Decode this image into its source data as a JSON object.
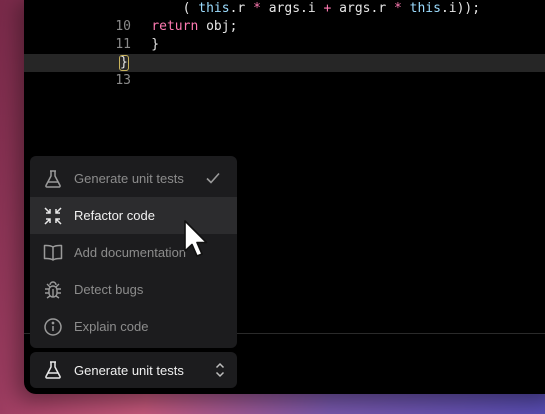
{
  "code": {
    "lines": [
      {
        "number": "10",
        "text": "        ( this.r * args.i + args.r * this.i));"
      },
      {
        "number": "11",
        "text": "    return obj;"
      },
      {
        "number": "12",
        "text": "    }"
      },
      {
        "number": "13",
        "text": "}"
      }
    ]
  },
  "menu": {
    "items": [
      {
        "label": "Generate unit tests",
        "icon": "flask-icon",
        "selected": true
      },
      {
        "label": "Refactor code",
        "icon": "compress-arrows-icon",
        "highlighted": true
      },
      {
        "label": "Add documentation",
        "icon": "book-icon"
      },
      {
        "label": "Detect bugs",
        "icon": "bug-icon"
      },
      {
        "label": "Explain code",
        "icon": "info-icon"
      }
    ]
  },
  "selector": {
    "label": "Generate unit tests",
    "icon": "flask-icon"
  },
  "colors": {
    "accent_keyword": "#ff7ab2",
    "menu_bg": "#1c1c1e",
    "menu_highlight": "#2c2c2e"
  }
}
